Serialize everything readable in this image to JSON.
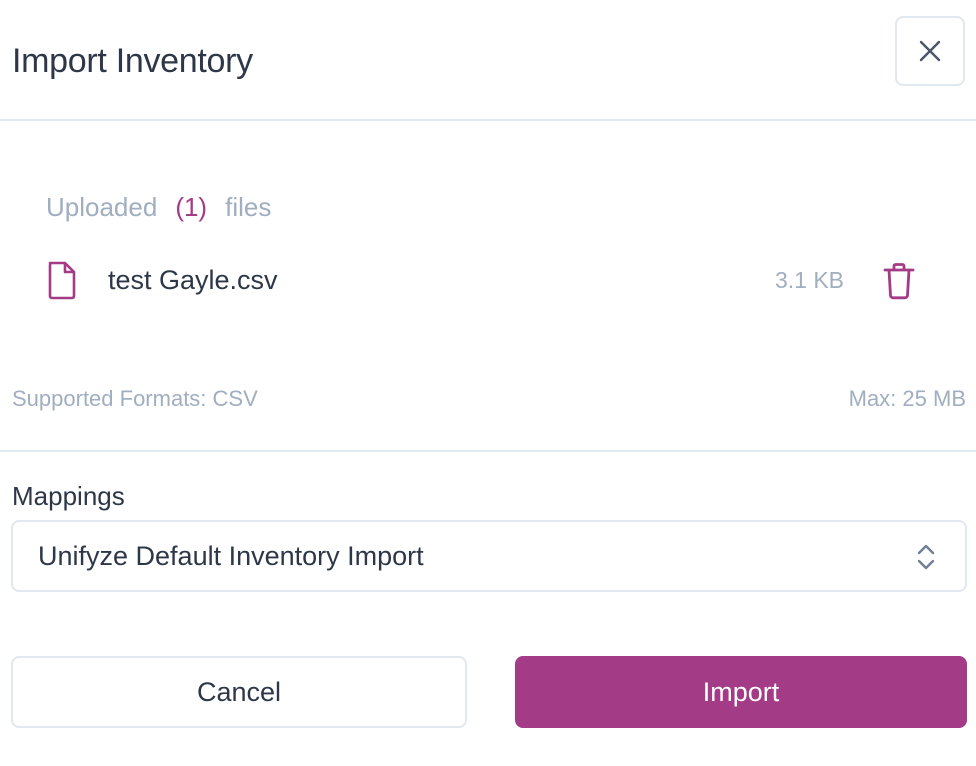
{
  "modal": {
    "title": "Import Inventory",
    "close_icon": "close-icon"
  },
  "uploads": {
    "prefix": "Uploaded",
    "count": "(1)",
    "suffix": "files",
    "files": [
      {
        "name": "test Gayle.csv",
        "size": "3.1 KB",
        "icon": "file-icon",
        "delete_icon": "trash-icon"
      }
    ]
  },
  "formats": {
    "supported": "Supported Formats: CSV",
    "max": "Max: 25 MB"
  },
  "mappings": {
    "label": "Mappings",
    "selected": "Unifyze Default Inventory Import",
    "icon": "chevron-up-down-icon"
  },
  "actions": {
    "cancel_label": "Cancel",
    "import_label": "Import"
  },
  "colors": {
    "accent": "#a43b86",
    "text": "#2d3748",
    "muted": "#a0aec0",
    "border": "#e2e8f0"
  }
}
